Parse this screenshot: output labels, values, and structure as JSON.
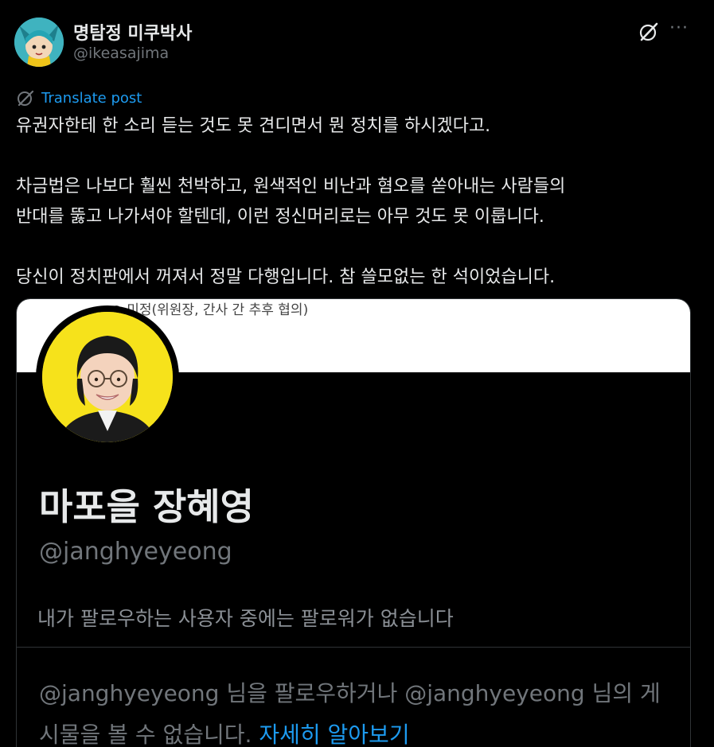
{
  "post": {
    "author": {
      "display_name": "명탐정 미쿠박사",
      "handle": "@ikeasajima",
      "avatar_icon": "anime-avatar"
    },
    "grok_icon": "grok-icon",
    "more_icon": "more-dots-icon",
    "translate": {
      "icon": "translate-icon",
      "label": "Translate post"
    },
    "text": {
      "line1": "유권자한테 한 소리 듣는 것도 못 견디면서 뭔 정치를 하시겠다고.",
      "line2": "차금법은 나보다 훨씬 천박하고, 원색적인 비난과 혐오를 쏟아내는 사람들의",
      "line3": "반대를 뚫고 나가셔야 할텐데, 이런 정신머리로는 아무 것도 못 이룹니다.",
      "line4": "당신이 정치판에서 꺼져서 정말 다행입니다. 참 쓸모없는 한 석이었습니다."
    }
  },
  "media": {
    "top_text": "○ 미정(위원장, 간사 간 추후 협의)",
    "profile": {
      "name": "마포을 장혜영",
      "handle": "@janghyeyeong",
      "follow_info": "내가 팔로우하는 사용자 중에는 팔로워가 없습니다",
      "protected_text": "@janghyeyeong 님을 팔로우하거나 @janghyeyeong 님의 게시물을 볼 수 없습니다.",
      "learn_more": "자세히 알아보기"
    }
  },
  "colors": {
    "background": "#000000",
    "text": "#e7e9ea",
    "secondary": "#71767b",
    "link": "#1d9bf0",
    "avatar_bg": "#f6e21b"
  }
}
